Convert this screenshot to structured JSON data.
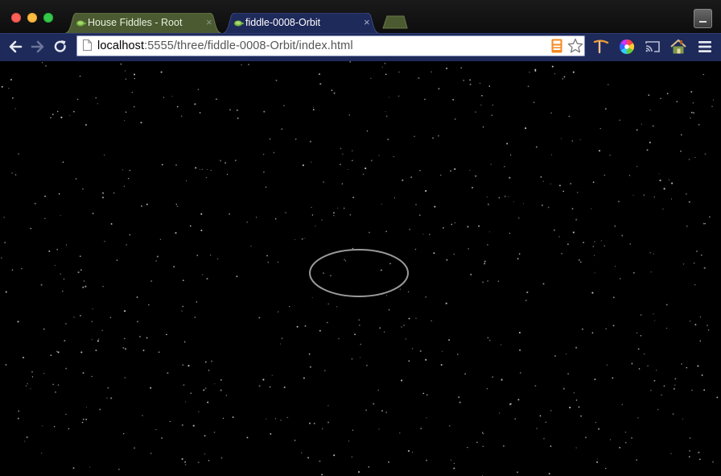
{
  "tabs": [
    {
      "title": "House Fiddles - Root",
      "close": "×",
      "active": false
    },
    {
      "title": "fiddle-0008-Orbit",
      "close": "×",
      "active": true
    }
  ],
  "omnibox": {
    "url_host": "localhost",
    "url_path": ":5555/three/fiddle-0008-Orbit/index.html"
  },
  "colors": {
    "toolbar": "#1e2a5a",
    "inactive_tab": "#4b5a30",
    "active_tab": "#1e2a5a",
    "scene_bg": "#000000",
    "orbit": "#9a9a9a"
  },
  "icons": [
    "back-icon",
    "forward-icon",
    "reload-icon",
    "page-icon",
    "calculator-icon",
    "bookmark-star-icon",
    "pickaxe-icon",
    "color-wheel-icon",
    "cast-icon",
    "house-extension-icon",
    "menu-icon"
  ]
}
